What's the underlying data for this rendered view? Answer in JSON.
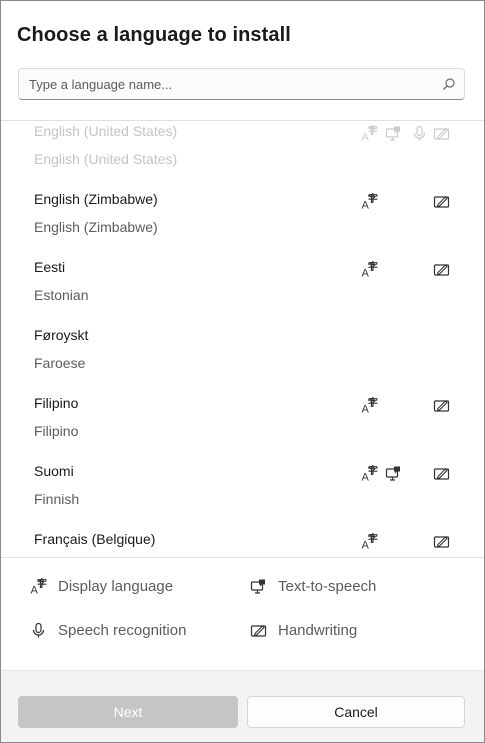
{
  "dialog": {
    "title": "Choose a language to install",
    "search": {
      "placeholder": "Type a language name...",
      "value": ""
    }
  },
  "languages": [
    {
      "name": "English (United States)",
      "english_name": "English (United States)",
      "features": [
        "display",
        "tts",
        "speech",
        "handwriting"
      ],
      "state": "scrolled-partially-hidden"
    },
    {
      "name": "English (Zimbabwe)",
      "english_name": "English (Zimbabwe)",
      "features": [
        "display",
        "handwriting"
      ]
    },
    {
      "name": "Eesti",
      "english_name": "Estonian",
      "features": [
        "display",
        "handwriting"
      ]
    },
    {
      "name": "Føroyskt",
      "english_name": "Faroese",
      "features": []
    },
    {
      "name": "Filipino",
      "english_name": "Filipino",
      "features": [
        "display",
        "handwriting"
      ]
    },
    {
      "name": "Suomi",
      "english_name": "Finnish",
      "features": [
        "display",
        "tts",
        "handwriting"
      ]
    },
    {
      "name": "Français (Belgique)",
      "english_name": "",
      "features": [
        "display",
        "handwriting"
      ]
    }
  ],
  "legend": {
    "display": {
      "label": "Display language",
      "icon": "display-language-icon"
    },
    "tts": {
      "label": "Text-to-speech",
      "icon": "text-to-speech-icon"
    },
    "speech": {
      "label": "Speech recognition",
      "icon": "microphone-icon"
    },
    "handwriting": {
      "label": "Handwriting",
      "icon": "handwriting-icon"
    }
  },
  "footer": {
    "next_label": "Next",
    "next_enabled": false,
    "cancel_label": "Cancel"
  },
  "colors": {
    "text_primary": "#1a1a1a",
    "text_secondary": "#5c5c5c",
    "disabled_button": "#c5c5c5",
    "footer_bg": "#f3f3f3"
  }
}
